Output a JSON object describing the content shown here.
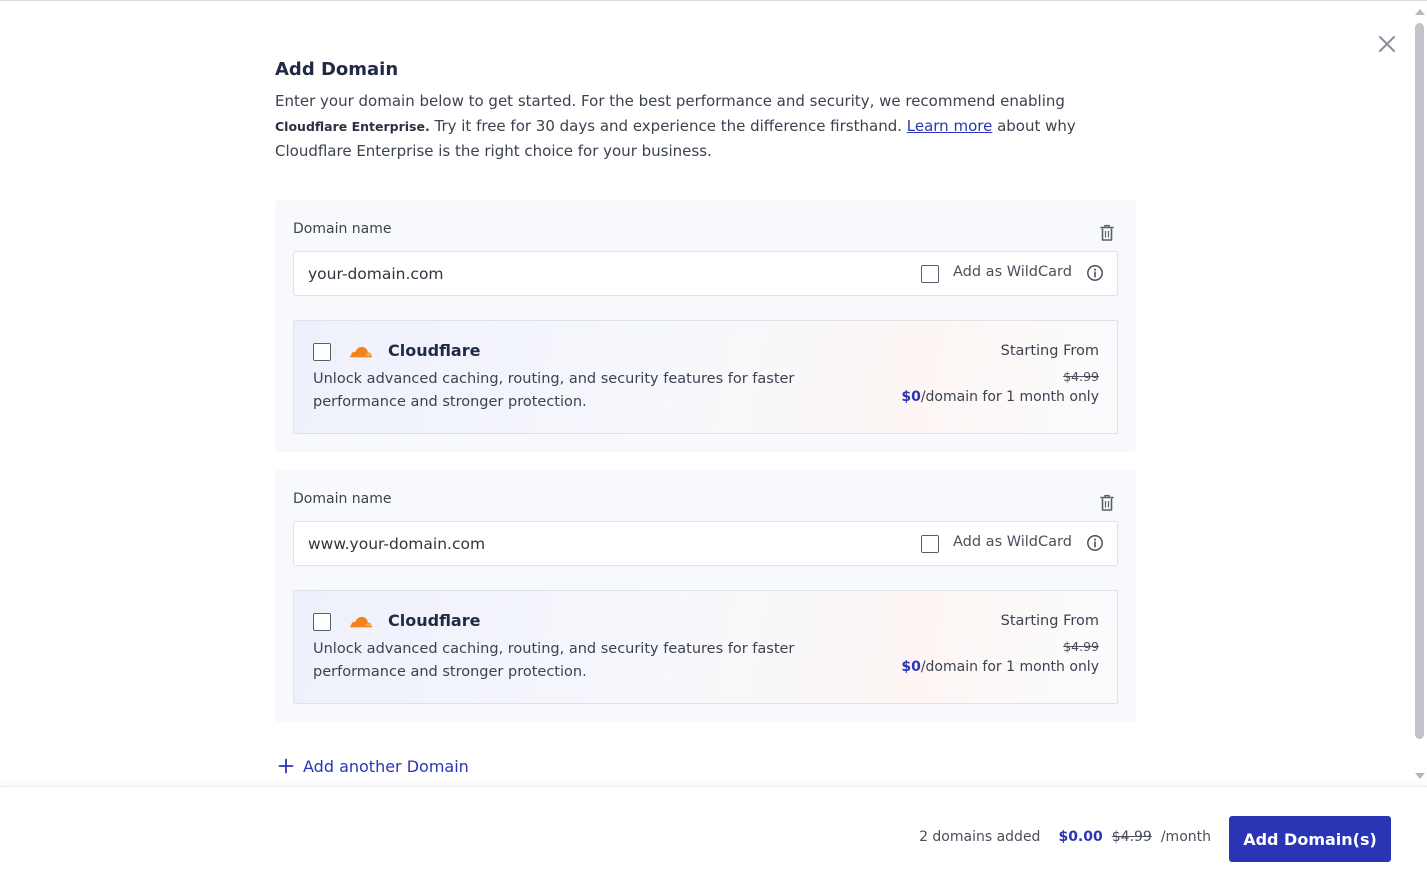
{
  "dialog": {
    "title": "Add Domain",
    "intro_part1": "Enter your domain below to get started. For the best performance and security, we recommend enabling ",
    "intro_brand": "Cloudflare Enterprise.",
    "intro_part2": " Try it free for 30 days and experience the difference firsthand. ",
    "intro_link": "Learn more",
    "intro_part3": " about why Cloudflare Enterprise is the right choice for your business.",
    "close_icon": "close-icon"
  },
  "domains": [
    {
      "label": "Domain name",
      "placeholder": "your-domain.com",
      "wildcard_label": "Add as WildCard",
      "cloudflare": {
        "name": "Cloudflare",
        "description": "Unlock advanced caching, routing, and security features for faster performance and stronger protection.",
        "price_title": "Starting From",
        "old_price": "$4.99",
        "new_price": "$0",
        "price_suffix": "/domain for 1 month only"
      }
    },
    {
      "label": "Domain name",
      "placeholder": "www.your-domain.com",
      "wildcard_label": "Add as WildCard",
      "cloudflare": {
        "name": "Cloudflare",
        "description": "Unlock advanced caching, routing, and security features for faster performance and stronger protection.",
        "price_title": "Starting From",
        "old_price": "$4.99",
        "new_price": "$0",
        "price_suffix": "/domain for 1 month only"
      }
    }
  ],
  "add_another_label": "Add another Domain",
  "footer": {
    "count_text": "2 domains added",
    "total": "$0.00",
    "old_total": "$4.99",
    "period": "/month",
    "button_label": "Add Domain(s)"
  },
  "colors": {
    "accent": "#2a35b6",
    "cloudflare_orange": "#f48120",
    "card_bg": "#f8f9fc"
  }
}
